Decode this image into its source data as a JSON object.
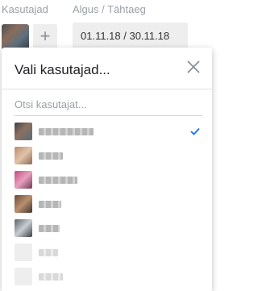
{
  "header": {
    "users_label": "Kasutajad",
    "dates_label": "Algus / Tähtaeg",
    "add_label": "+",
    "date_range": "01.11.18 / 30.11.18"
  },
  "popup": {
    "title": "Vali kasutajad...",
    "search_placeholder": "Otsi kasutajat..."
  },
  "users": [
    {
      "selected": true,
      "avatar": "photo"
    },
    {
      "selected": false,
      "avatar": "photo"
    },
    {
      "selected": false,
      "avatar": "photo"
    },
    {
      "selected": false,
      "avatar": "photo"
    },
    {
      "selected": false,
      "avatar": "photo"
    },
    {
      "selected": false,
      "avatar": "placeholder"
    },
    {
      "selected": false,
      "avatar": "placeholder"
    }
  ],
  "colors": {
    "accent": "#1a73e8",
    "field_bg": "#eeeeee",
    "label": "#9aa0a6"
  }
}
